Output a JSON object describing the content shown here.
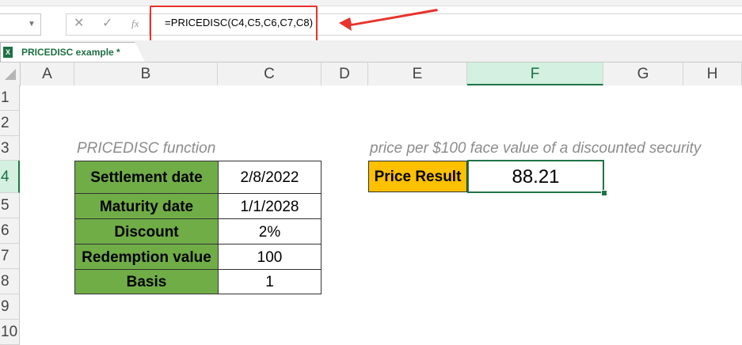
{
  "formula_bar": {
    "cancel_icon": "x-icon",
    "enter_icon": "check-icon",
    "fx_label": "fx",
    "formula": "=PRICEDISC(C4,C5,C6,C7,C8)"
  },
  "sheet_tab": {
    "label": "PRICEDISC example *"
  },
  "columns": [
    "A",
    "B",
    "C",
    "D",
    "E",
    "F",
    "G",
    "H"
  ],
  "rows": [
    "1",
    "2",
    "3",
    "4",
    "5",
    "6",
    "7",
    "8",
    "9",
    "10"
  ],
  "cells": {
    "B3": "PRICEDISC function",
    "E3": "price per $100 face value of a discounted security",
    "table": [
      {
        "label": "Settlement date",
        "value": "2/8/2022"
      },
      {
        "label": "Maturity date",
        "value": "1/1/2028"
      },
      {
        "label": "Discount",
        "value": "2%"
      },
      {
        "label": "Redemption value",
        "value": "100"
      },
      {
        "label": "Basis",
        "value": "1"
      }
    ],
    "E4": "Price Result",
    "F4": "88.21"
  },
  "colors": {
    "label_fill": "#70ad47",
    "result_label_fill": "#ffc000",
    "highlight_red": "#e8322b",
    "selection_green": "#217346"
  }
}
